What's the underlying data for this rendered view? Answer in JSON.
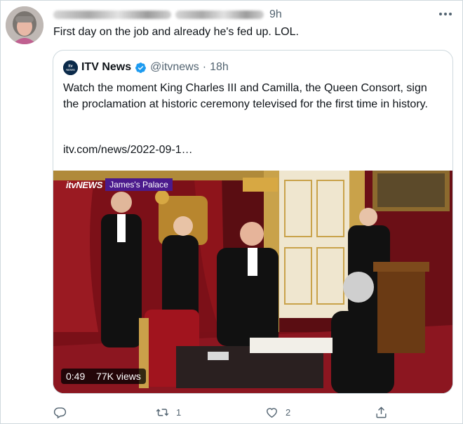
{
  "tweet": {
    "time": "9h",
    "text": "First day on the job and already he's fed up. LOL.",
    "more_icon": "more-horizontal-icon"
  },
  "quoted": {
    "name": "ITV News",
    "handle": "@itvnews",
    "separator": "·",
    "time": "18h",
    "text": "Watch the moment King Charles III and Camilla, the Queen Consort, sign the proclamation at historic ceremony televised for the first time in history.",
    "link": "itv.com/news/2022-09-1…",
    "avatar_label": "itv NEWS",
    "verified_icon": "verified-badge-icon"
  },
  "media": {
    "logo": "itvNEWS",
    "location": "James's Palace",
    "duration": "0:49",
    "views": "77K views"
  },
  "actions": {
    "reply": {
      "icon": "reply-icon",
      "count": ""
    },
    "retweet": {
      "icon": "retweet-icon",
      "count": "1"
    },
    "like": {
      "icon": "like-icon",
      "count": "2"
    },
    "share": {
      "icon": "share-icon",
      "count": ""
    }
  },
  "colors": {
    "text": "#0f1419",
    "secondary": "#536471",
    "border": "#cfd9de",
    "verified": "#1d9bf0",
    "label_purple": "#4b1a8c"
  }
}
